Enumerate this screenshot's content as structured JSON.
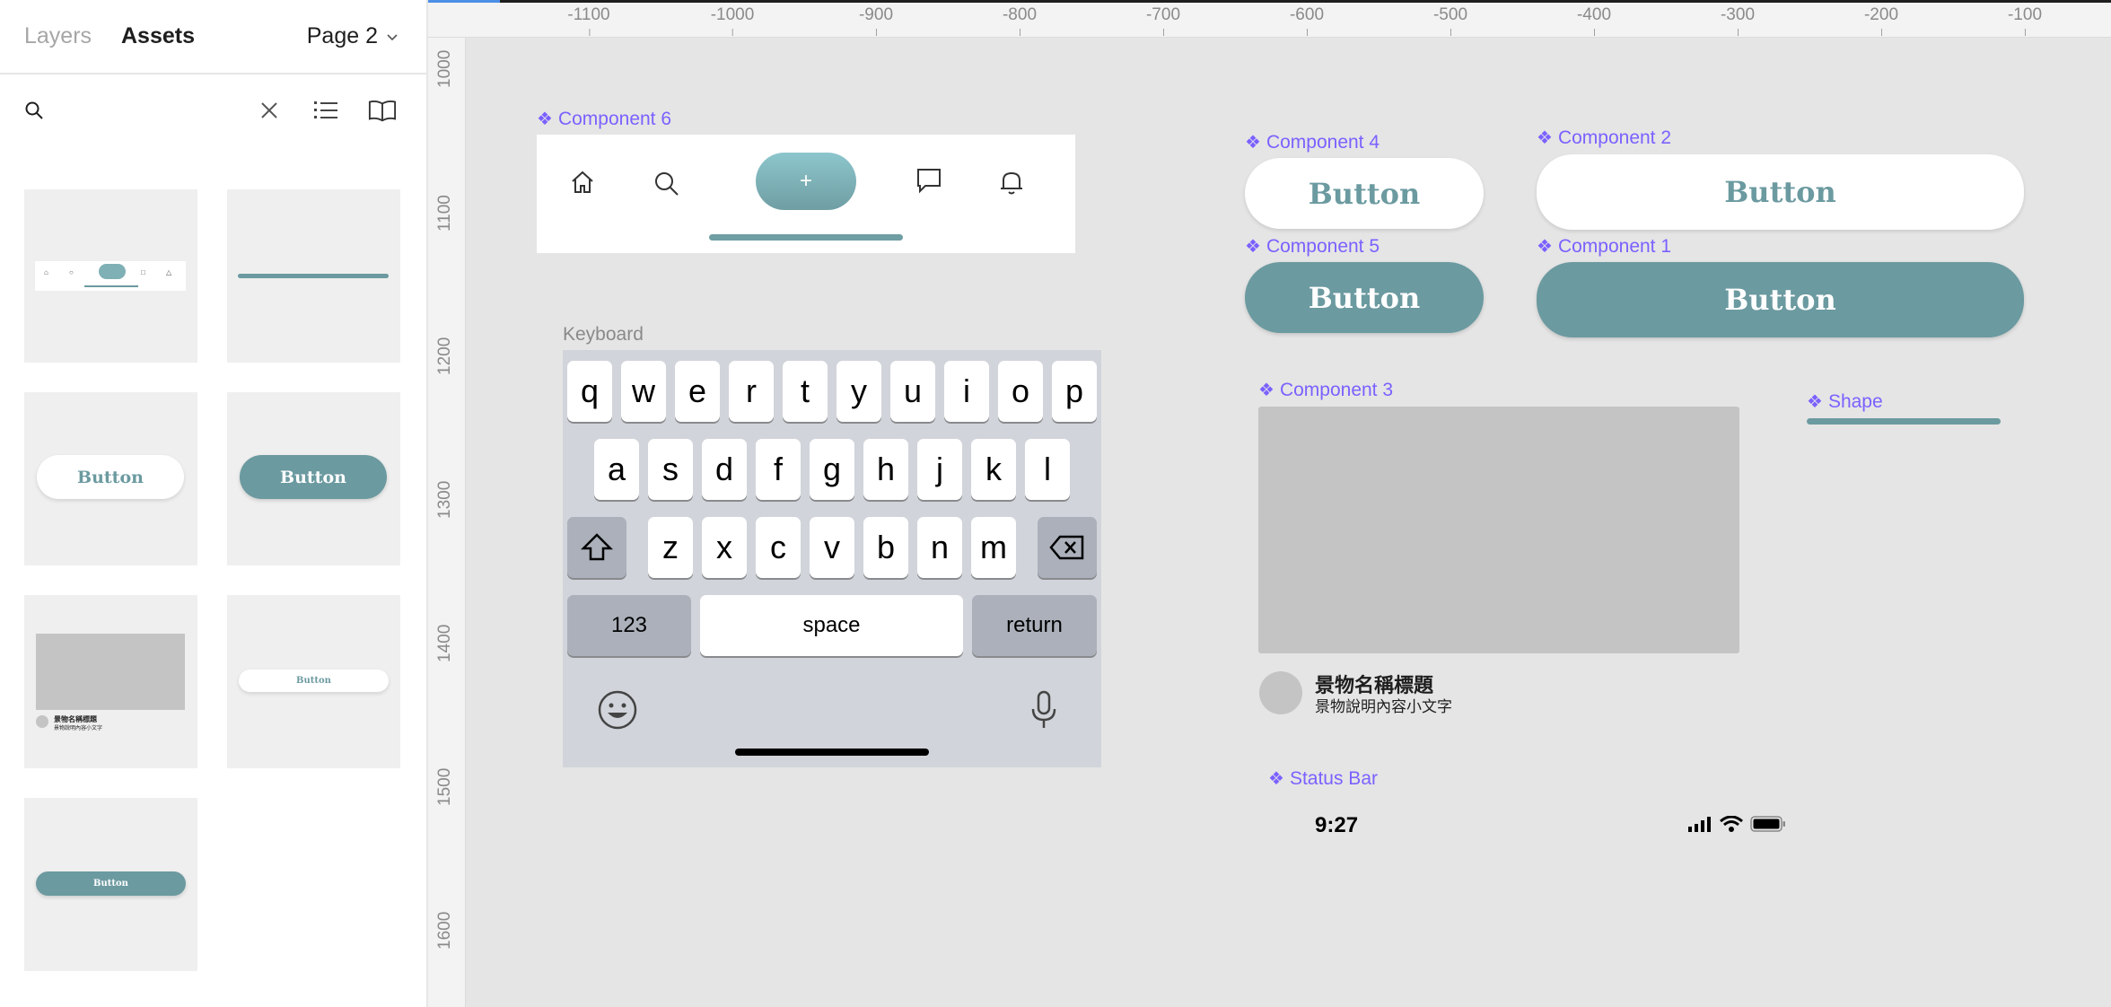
{
  "panel": {
    "tabs": {
      "layers": "Layers",
      "assets": "Assets"
    },
    "page_selector": "Page 2",
    "search": {
      "placeholder": ""
    },
    "icons": [
      "search-icon",
      "close-icon",
      "list-view-icon",
      "library-book-icon"
    ],
    "thumbnails": {
      "t3_label": "Button",
      "t4_label": "Button",
      "t6_label": "Button",
      "t7_label": "Button",
      "t5_title": "景物名稱標題",
      "t5_sub": "景物說明內容小文字"
    }
  },
  "rulers": {
    "x_ticks": [
      "-1100",
      "-1000",
      "-900",
      "-800",
      "-700",
      "-600",
      "-500",
      "-400",
      "-300",
      "-200",
      "-100"
    ],
    "y_ticks": [
      "1000",
      "1100",
      "1200",
      "1300",
      "1400",
      "1500",
      "1600"
    ]
  },
  "canvas": {
    "component6": {
      "label": "Component 6",
      "plus": "+"
    },
    "component4": {
      "label": "Component 4",
      "button": "Button"
    },
    "component2": {
      "label": "Component 2",
      "button": "Button"
    },
    "component5": {
      "label": "Component 5",
      "button": "Button"
    },
    "component1": {
      "label": "Component 1",
      "button": "Button"
    },
    "keyboard": {
      "label": "Keyboard",
      "row1": [
        "q",
        "w",
        "e",
        "r",
        "t",
        "y",
        "u",
        "i",
        "o",
        "p"
      ],
      "row2": [
        "a",
        "s",
        "d",
        "f",
        "g",
        "h",
        "j",
        "k",
        "l"
      ],
      "row3": [
        "z",
        "x",
        "c",
        "v",
        "b",
        "n",
        "m"
      ],
      "numbers": "123",
      "space": "space",
      "return": "return"
    },
    "component3": {
      "label": "Component 3",
      "title": "景物名稱標題",
      "subtitle": "景物說明內容小文字"
    },
    "shape": {
      "label": "Shape"
    },
    "status_bar": {
      "label": "Status Bar",
      "time": "9:27"
    }
  },
  "colors": {
    "accent_teal": "#6b9aa0",
    "component_label": "#7b61ff",
    "canvas_bg": "#e5e5e5"
  }
}
